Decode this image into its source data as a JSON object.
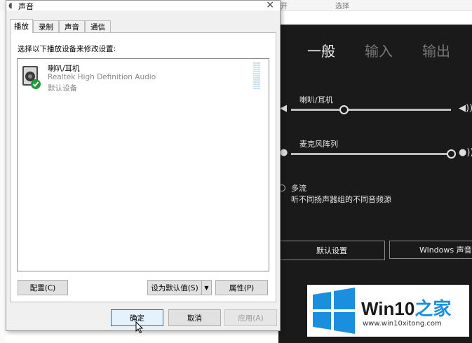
{
  "background_window": {
    "top_texts": [
      "开",
      "选择"
    ]
  },
  "dialog": {
    "title": "声音",
    "close_glyph": "×",
    "tabs": [
      {
        "label": "播放",
        "active": true
      },
      {
        "label": "录制",
        "active": false
      },
      {
        "label": "声音",
        "active": false
      },
      {
        "label": "通信",
        "active": false
      }
    ],
    "instruction": "选择以下播放设备来修改设置:",
    "devices": [
      {
        "name": "喇叭/耳机",
        "description": "Realtek High Definition Audio",
        "status": "默认设备",
        "is_default": true
      }
    ],
    "panel_buttons": {
      "configure": "配置(C)",
      "set_default": "设为默认值(S)",
      "dropdown_glyph": "▼",
      "properties": "属性(P)"
    },
    "footer_buttons": {
      "ok": "确定",
      "cancel": "取消",
      "apply": "应用(A)"
    }
  },
  "realtek_panel": {
    "tabs": [
      "一般",
      "输入",
      "输出"
    ],
    "active_tab": "一般",
    "speaker": {
      "label": "喇叭/耳机",
      "level": 0.33
    },
    "mic": {
      "label": "麦克风阵列",
      "level": 1.0
    },
    "multistream": {
      "label": "多流",
      "description": "听不同扬声器组的不同音频源"
    },
    "buttons": {
      "default_settings": "默认设置",
      "windows_sound": "Windows 声音属"
    }
  },
  "watermark": {
    "brand_prefix": "Win10",
    "brand_suffix": "之家",
    "url": "www.win10xitong.com",
    "colors": {
      "blue": "#1a8fe0"
    }
  }
}
